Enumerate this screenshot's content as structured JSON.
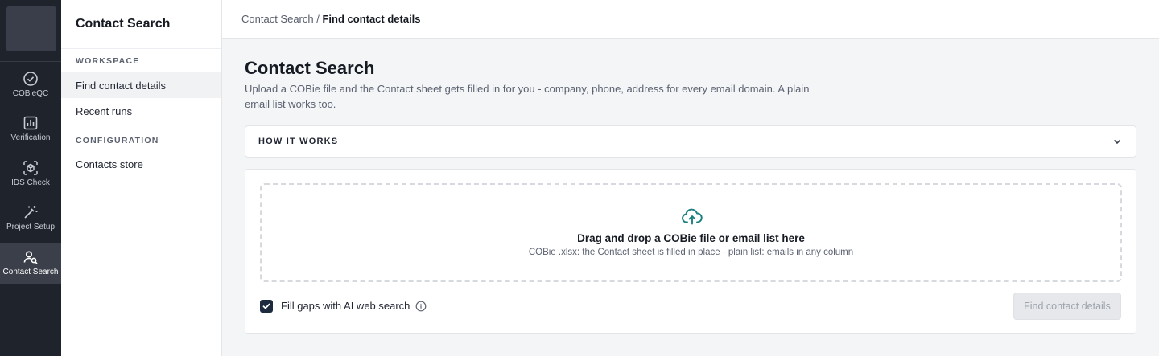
{
  "rail": {
    "items": [
      {
        "label": "COBieQC",
        "icon": "check-circle-icon"
      },
      {
        "label": "Verification",
        "icon": "bar-chart-icon"
      },
      {
        "label": "IDS Check",
        "icon": "cube-scan-icon"
      },
      {
        "label": "Project Setup",
        "icon": "magic-wand-icon"
      },
      {
        "label": "Contact Search",
        "icon": "user-search-icon",
        "active": true
      }
    ]
  },
  "sidebar": {
    "title": "Contact Search",
    "sections": [
      {
        "heading": "WORKSPACE",
        "items": [
          {
            "label": "Find contact details",
            "active": true
          },
          {
            "label": "Recent runs"
          }
        ]
      },
      {
        "heading": "CONFIGURATION",
        "items": [
          {
            "label": "Contacts store"
          }
        ]
      }
    ]
  },
  "breadcrumb": {
    "parent": "Contact Search",
    "separator": " / ",
    "current": "Find contact details"
  },
  "main": {
    "title": "Contact Search",
    "description": "Upload a COBie file and the Contact sheet gets filled in for you - company, phone, address for every email domain. A plain email list works too.",
    "how_it_works": {
      "label": "HOW IT WORKS",
      "icon": "chevron-down-icon"
    },
    "dropzone": {
      "icon": "cloud-upload-icon",
      "title": "Drag and drop a COBie file or email list here",
      "subtitle": "COBie .xlsx: the Contact sheet is filled in place · plain list: emails in any column"
    },
    "ai_search": {
      "label": "Fill gaps with AI web search",
      "checked": true,
      "icon": "info-icon"
    },
    "submit": {
      "label": "Find contact details",
      "disabled": true
    }
  },
  "colors": {
    "accent": "#1a7f80",
    "rail_bg": "#1f232b",
    "checkbox": "#1e2a3d"
  }
}
